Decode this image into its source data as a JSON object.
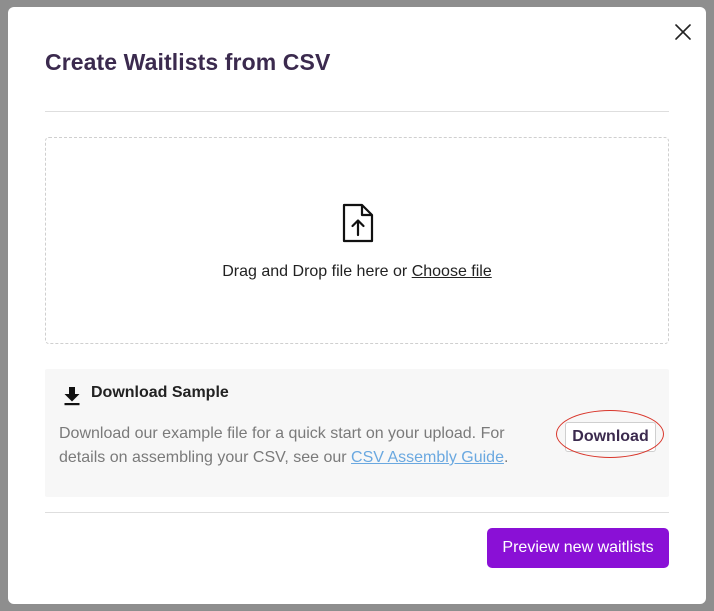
{
  "modal": {
    "title": "Create Waitlists from CSV"
  },
  "dropzone": {
    "text": "Drag and Drop file here or ",
    "choose_link": "Choose file"
  },
  "sample": {
    "heading": "Download Sample",
    "description": "Download our example file for a quick start on your upload. For details on assembling your CSV, see our ",
    "guide_link": "CSV Assembly Guide",
    "description_end": ".",
    "download_label": "Download"
  },
  "footer": {
    "preview_label": "Preview new waitlists"
  },
  "icons": {
    "close": "close-icon",
    "upload": "file-upload-icon",
    "download": "download-icon"
  },
  "colors": {
    "primary": "#8a10d6",
    "title": "#3b2a4e",
    "link": "#6aa8e0",
    "highlight": "#d9362b"
  }
}
